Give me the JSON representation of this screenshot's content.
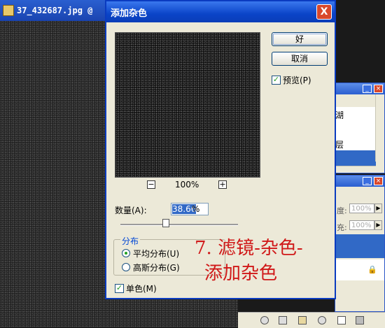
{
  "document": {
    "title": "37_432687.jpg @",
    "file_icon": "image-file-icon"
  },
  "panels": {
    "history_rows": [
      "湖",
      "",
      "层",
      ""
    ],
    "opacity_label": "度:",
    "opacity_value": "100%",
    "fill_label": "充:",
    "fill_value": "100%"
  },
  "dialog": {
    "title": "添加杂色",
    "close_label": "X",
    "ok_label": "好",
    "cancel_label": "取消",
    "preview_label": "预览(P)",
    "preview_checked": true,
    "zoom_out_label": "−",
    "zoom_in_label": "+",
    "zoom_level": "100%",
    "amount_label": "数量(A):",
    "amount_value": "38.66",
    "amount_unit": "%",
    "amount_slider_fraction": 0.3866,
    "distribution_title": "分布",
    "dist_uniform_label": "平均分布(U)",
    "dist_gaussian_label": "高斯分布(G)",
    "selected_distribution": "uniform",
    "monochrome_label": "单色(M)",
    "monochrome_checked": true
  },
  "annotation": {
    "line1": "7. 滤镜-杂色-",
    "line2": "添加杂色",
    "color": "#d01818"
  }
}
